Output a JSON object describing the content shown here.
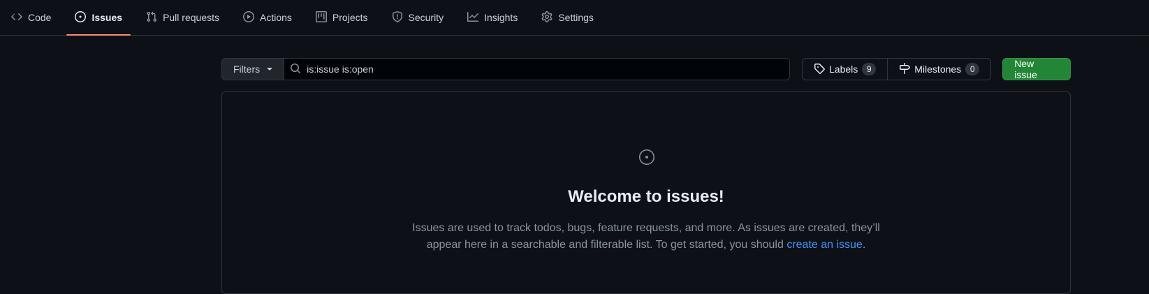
{
  "nav": {
    "items": [
      {
        "label": "Code",
        "icon": "code-icon"
      },
      {
        "label": "Issues",
        "icon": "issue-opened-icon",
        "selected": true
      },
      {
        "label": "Pull requests",
        "icon": "git-pull-request-icon"
      },
      {
        "label": "Actions",
        "icon": "play-icon"
      },
      {
        "label": "Projects",
        "icon": "table-icon"
      },
      {
        "label": "Security",
        "icon": "shield-icon"
      },
      {
        "label": "Insights",
        "icon": "graph-icon"
      },
      {
        "label": "Settings",
        "icon": "gear-icon"
      }
    ],
    "selected_underline_color": "#fd8c73"
  },
  "subnav": {
    "filters_label": "Filters",
    "search_value": "is:issue is:open",
    "labels_label": "Labels",
    "labels_count": "9",
    "milestones_label": "Milestones",
    "milestones_count": "0",
    "new_issue_label": "New issue"
  },
  "blankslate": {
    "icon": "issue-opened-icon",
    "title": "Welcome to issues!",
    "line1": "Issues are used to track todos, bugs, feature requests, and more. As issues are created, they’ll",
    "line2_prefix": "appear here in a searchable and filterable list. To get started, you should ",
    "link_text": "create an issue",
    "line2_suffix": "."
  },
  "colors": {
    "background": "#0d1117",
    "border": "#30363d",
    "accent_link": "#4493f8",
    "primary_button": "#238636"
  }
}
